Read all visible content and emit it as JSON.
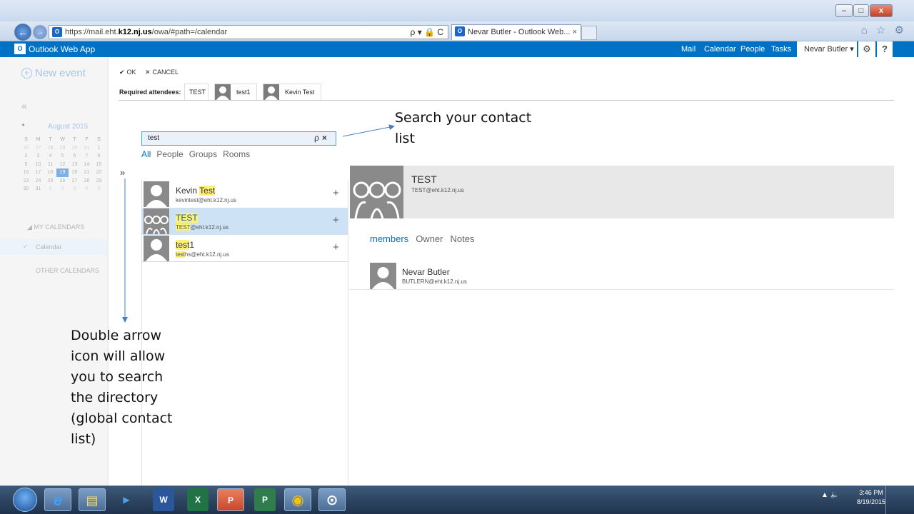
{
  "browser": {
    "url_prefix": "https://mail.eht.",
    "url_domain": "k12.nj.us",
    "url_path": "/owa/#path=/calendar",
    "url_tools": "ρ ▾ 🔒 C",
    "tab_title": "Nevar Butler - Outlook Web...",
    "tab_close": "×",
    "favicon": "O",
    "window_controls": [
      "–",
      "□",
      "x"
    ],
    "chrome_icons": "⌂ ☆ ⚙"
  },
  "owa": {
    "app_name": "Outlook Web App",
    "logo_glyph": "O",
    "nav": [
      "Mail",
      "Calendar",
      "People",
      "Tasks"
    ],
    "user": "Nevar Butler ▾",
    "gear": "⚙",
    "help": "?"
  },
  "left_pane": {
    "new_event": "New event",
    "new_event_icon": "+",
    "collapse": "«",
    "prev_month": "◂",
    "month_title": "August 2015",
    "weekday_headers": [
      "S",
      "M",
      "T",
      "W",
      "T",
      "F",
      "S"
    ],
    "weeks": [
      [
        "26",
        "27",
        "28",
        "29",
        "30",
        "31",
        "1"
      ],
      [
        "2",
        "3",
        "4",
        "5",
        "6",
        "7",
        "8"
      ],
      [
        "9",
        "10",
        "11",
        "12",
        "13",
        "14",
        "15"
      ],
      [
        "16",
        "17",
        "18",
        "19",
        "20",
        "21",
        "22"
      ],
      [
        "23",
        "24",
        "25",
        "26",
        "27",
        "28",
        "29"
      ],
      [
        "30",
        "31",
        "1",
        "2",
        "3",
        "4",
        "5"
      ]
    ],
    "today": "19",
    "my_calendars": "◢ MY CALENDARS",
    "calendar_check": "✓",
    "calendar_item": "Calendar",
    "other_calendars": "OTHER CALENDARS"
  },
  "toolbar": {
    "ok_icon": "✔",
    "ok_label": "OK",
    "cancel_icon": "✕",
    "cancel_label": "CANCEL",
    "required_label": "Required attendees:",
    "attendees": [
      "TEST",
      "test1",
      "Kevin Test"
    ]
  },
  "search": {
    "value": "test",
    "search_icon": "ρ",
    "clear_icon": "×",
    "filters": [
      "All",
      "People",
      "Groups",
      "Rooms"
    ],
    "directory_toggle": "»"
  },
  "results": [
    {
      "name_pre": "Kevin ",
      "name_hl": "Test",
      "name_post": "",
      "email_hl": "",
      "email_rest": "kevintest@eht.k12.nj.us",
      "add": "+"
    },
    {
      "name_pre": "",
      "name_hl": "TEST",
      "name_post": "",
      "email_hl": "TEST",
      "email_rest": "@eht.k12.nj.us",
      "add": "+"
    },
    {
      "name_pre": "",
      "name_hl": "test",
      "name_post": "1",
      "email_hl": "test",
      "email_rest": "hs@eht.k12.nj.us",
      "add": "+"
    }
  ],
  "detail": {
    "name": "TEST",
    "email": "TEST@eht.k12.nj.us",
    "tabs": [
      "members",
      "Owner",
      "Notes"
    ],
    "member_name": "Nevar Butler",
    "member_email": "BUTLERN@eht.k12.nj.us"
  },
  "annotations": {
    "search_note": "Search your contact list",
    "directory_note": "Double arrow icon will allow you to search the directory (global contact list)"
  },
  "taskbar": {
    "apps": [
      "e",
      "▤",
      "▶",
      "W",
      "X",
      "P",
      "P",
      "◉",
      "⊙"
    ],
    "tray_icons": "▲ 🔈",
    "time": "3:46 PM",
    "date": "8/19/2015"
  }
}
